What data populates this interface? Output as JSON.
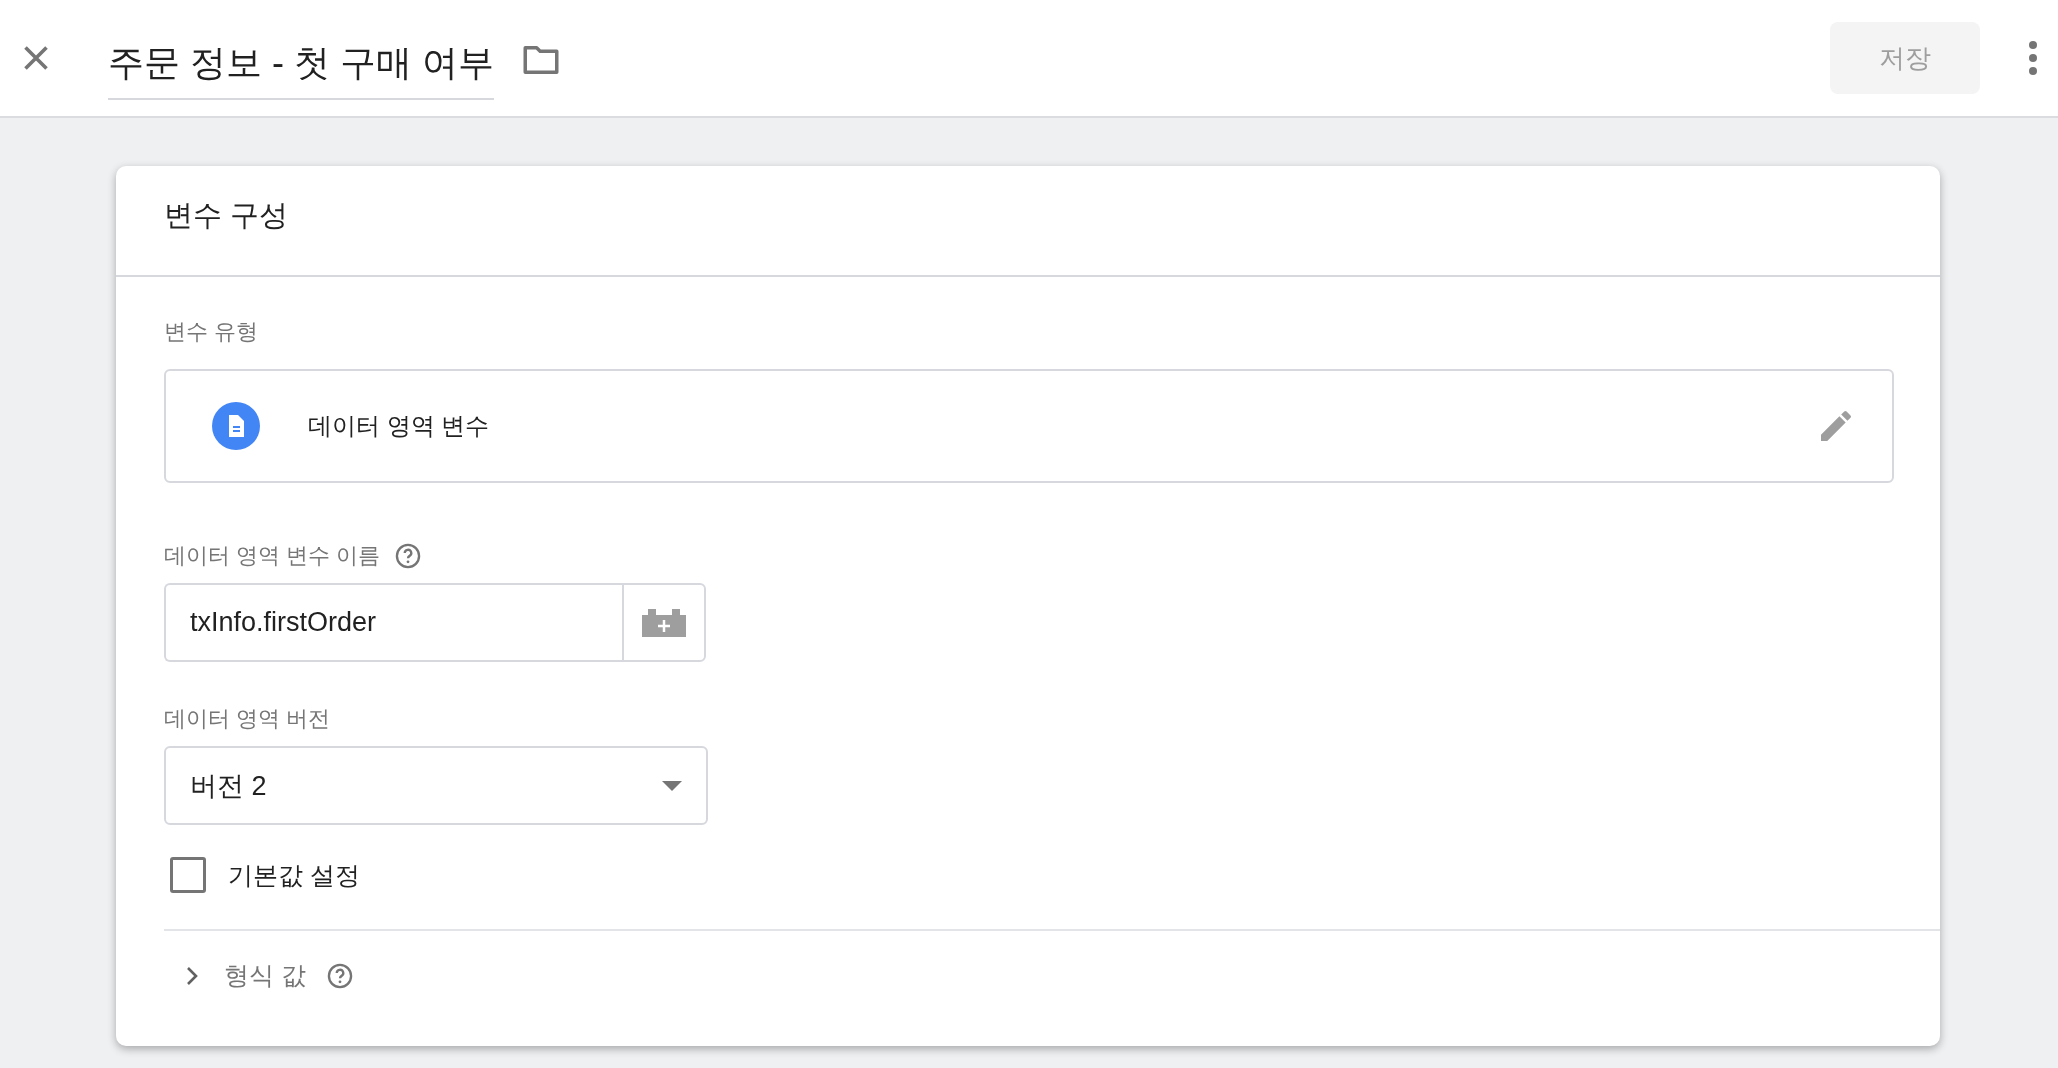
{
  "header": {
    "title": "주문 정보 - 첫 구매 여부",
    "save_button": {
      "label": "저장",
      "disabled": true
    }
  },
  "card": {
    "title": "변수 구성",
    "variable_type": {
      "label": "변수 유형",
      "value": "데이터 영역 변수"
    },
    "name_field": {
      "label": "데이터 영역 변수 이름",
      "value": "txInfo.firstOrder"
    },
    "version_field": {
      "label": "데이터 영역 버전",
      "value": "버전 2"
    },
    "default_value": {
      "label": "기본값 설정",
      "checked": false
    },
    "format_value": {
      "label": "형식 값",
      "expanded": false
    }
  }
}
